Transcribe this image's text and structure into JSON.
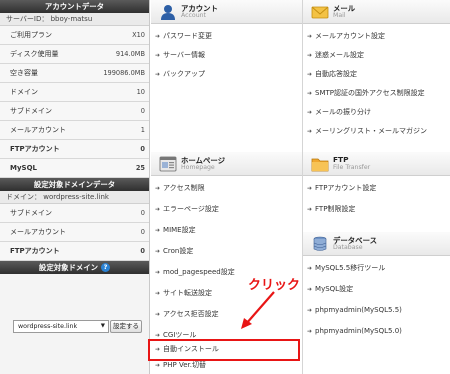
{
  "account_panel": {
    "title": "アカウントデータ",
    "server_id": "サーバーID： bboy-matsu",
    "rows": [
      {
        "label": "ご利用プラン",
        "value": "X10"
      },
      {
        "label": "ディスク使用量",
        "value": "914.0MB"
      },
      {
        "label": "空き容量",
        "value": "199086.0MB"
      },
      {
        "label": "ドメイン",
        "value": "10"
      },
      {
        "label": "サブドメイン",
        "value": "0"
      },
      {
        "label": "メールアカウント",
        "value": "1"
      },
      {
        "label": "FTPアカウント",
        "value": "0"
      },
      {
        "label": "MySQL",
        "value": "25"
      }
    ]
  },
  "domain_panel": {
    "title": "設定対象ドメインデータ",
    "domain": "ドメイン： wordpress-site.link",
    "rows": [
      {
        "label": "サブドメイン",
        "value": "0"
      },
      {
        "label": "メールアカウント",
        "value": "0"
      },
      {
        "label": "FTPアカウント",
        "value": "0"
      }
    ]
  },
  "domain_select": {
    "title": "設定対象ドメイン",
    "help": "?",
    "selected": "wordpress-site.link",
    "button": "設定する"
  },
  "sections": {
    "account": {
      "title": "アカウント",
      "subtitle": "Account",
      "links": [
        "パスワード変更",
        "サーバー情報",
        "バックアップ"
      ]
    },
    "mail": {
      "title": "メール",
      "subtitle": "Mail",
      "links": [
        "メールアカウント設定",
        "迷惑メール設定",
        "自動応答設定",
        "SMTP認証の国外アクセス制限設定",
        "メールの振り分け",
        "メーリングリスト・メールマガジン"
      ]
    },
    "homepage": {
      "title": "ホームページ",
      "subtitle": "Homepage",
      "links": [
        "アクセス制限",
        "エラーページ設定",
        "MIME設定",
        "Cron設定",
        "mod_pagespeed設定",
        "サイト転送設定",
        "アクセス拒否設定",
        "CGIツール",
        "自動インストール",
        "PHP Ver.切替"
      ]
    },
    "ftp": {
      "title": "FTP",
      "subtitle": "File Transfer",
      "links": [
        "FTPアカウント設定",
        "FTP制限設定"
      ]
    },
    "database": {
      "title": "データベース",
      "subtitle": "Database",
      "links": [
        "MySQL5.5移行ツール",
        "MySQL設定",
        "phpmyadmin(MySQL5.5)",
        "phpmyadmin(MySQL5.0)"
      ]
    }
  },
  "annotation": {
    "click_label": "クリック",
    "highlight_color": "#e81515"
  }
}
